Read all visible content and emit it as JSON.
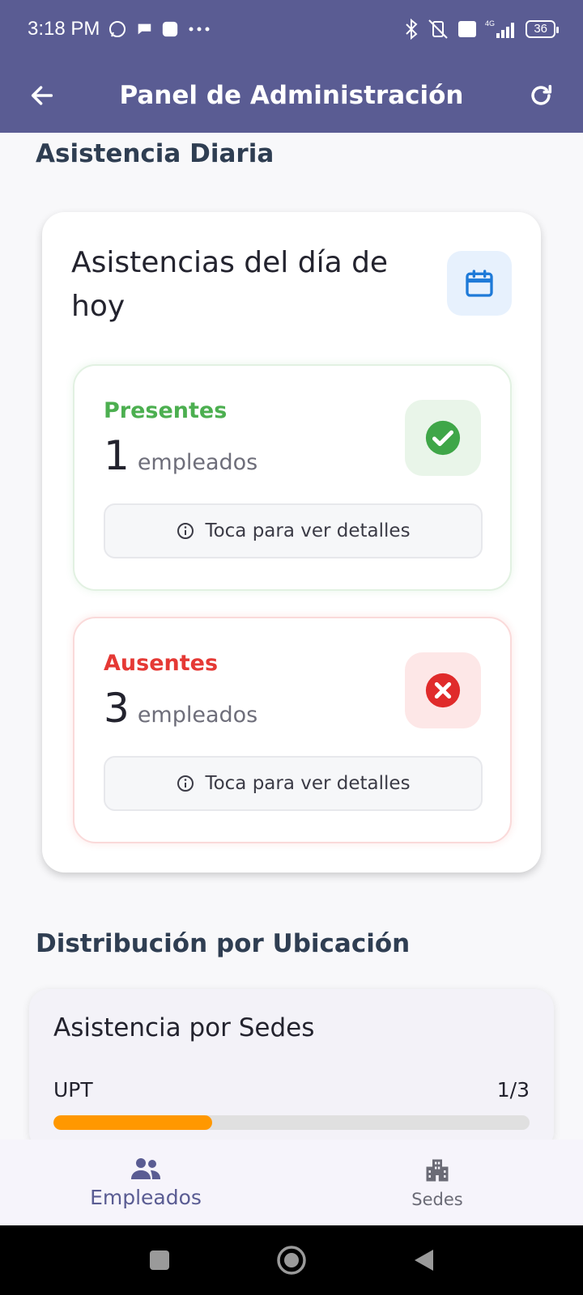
{
  "status_bar": {
    "time": "3:18 PM",
    "battery": "36",
    "network": "4G"
  },
  "app_bar": {
    "title": "Panel de Administración",
    "back_icon": "arrow-back-icon",
    "refresh_icon": "refresh-icon"
  },
  "daily": {
    "section_title": "Asistencia Diaria",
    "card_title": "Asistencias del día de hoy",
    "present": {
      "label": "Presentes",
      "count": "1",
      "unit": "empleados",
      "details": "Toca para ver detalles",
      "color": "#4caf50"
    },
    "absent": {
      "label": "Ausentes",
      "count": "3",
      "unit": "empleados",
      "details": "Toca para ver detalles",
      "color": "#e53935"
    }
  },
  "location": {
    "section_title": "Distribución por Ubicación",
    "card_title": "Asistencia por Sedes",
    "sedes": [
      {
        "name": "UPT",
        "value": "1/3",
        "fraction": 0.333,
        "color": "#ff9800"
      }
    ]
  },
  "bottom_nav": [
    {
      "label": "Empleados",
      "icon": "people-icon",
      "active": true
    },
    {
      "label": "Sedes",
      "icon": "building-icon",
      "active": false
    }
  ],
  "colors": {
    "primary": "#5a5c93",
    "background": "#f8f8fa"
  }
}
